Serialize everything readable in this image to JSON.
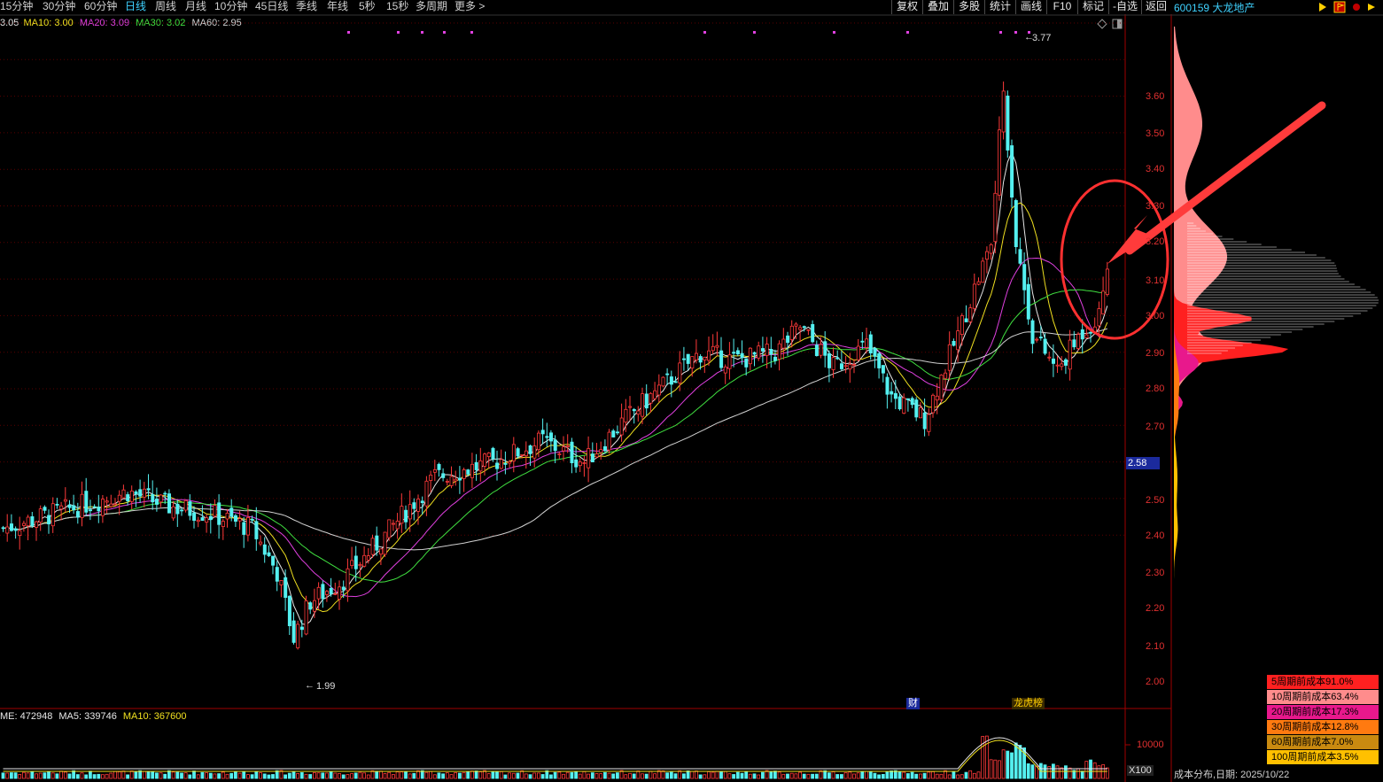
{
  "toolbar": {
    "periods": [
      "15分钟",
      "30分钟",
      "60分钟",
      "日线",
      "周线",
      "月线",
      "10分钟",
      "45日线",
      "季线",
      "年线",
      "5秒",
      "15秒",
      "多周期",
      "更多 >"
    ],
    "active_index": 3,
    "right_buttons": [
      "复权",
      "叠加",
      "多股",
      "统计",
      "画线",
      "F10",
      "标记",
      "-自选",
      "返回"
    ]
  },
  "stock": {
    "code_name": "600159 大龙地产"
  },
  "ma_legend": {
    "ma5": "3.05",
    "ma10": "MA10: 3.00",
    "ma20": "MA20: 3.09",
    "ma30": "MA30: 3.02",
    "ma60": "MA60: 2.95"
  },
  "vol_legend": {
    "volume": "ME: 472948",
    "ma5": "MA5: 339746",
    "ma10": "MA10: 367600"
  },
  "price_axis": {
    "labels": [
      "3.60",
      "3.50",
      "3.40",
      "3.30",
      "3.20",
      "3.10",
      "3.00",
      "2.90",
      "2.80",
      "2.70",
      "2.50",
      "2.40",
      "2.30",
      "2.20",
      "2.10",
      "2.00"
    ],
    "current_price": "2.58"
  },
  "volume_axis": {
    "label": "10000",
    "unit": "X100"
  },
  "annotations": {
    "high": "3.77",
    "low": "1.99",
    "badge_fin": "财",
    "badge_rank": "龙虎榜"
  },
  "cost_distribution": {
    "rows": [
      {
        "text": "5周期前成本91.0%",
        "color": "#ff2020"
      },
      {
        "text": "10周期前成本63.4%",
        "color": "#ff8c8c"
      },
      {
        "text": "20周期前成本17.3%",
        "color": "#e8188c"
      },
      {
        "text": "30周期前成本12.8%",
        "color": "#ff7a10"
      },
      {
        "text": "60周期前成本7.0%",
        "color": "#c98a10"
      },
      {
        "text": "100周期前成本3.5%",
        "color": "#ffc000"
      }
    ],
    "footer": "成本分布,日期: 2025/10/22"
  },
  "colors": {
    "up": "#ff3a3a",
    "down": "#54f0f0",
    "axis": "#a00000",
    "grid": "#5a0000"
  }
}
